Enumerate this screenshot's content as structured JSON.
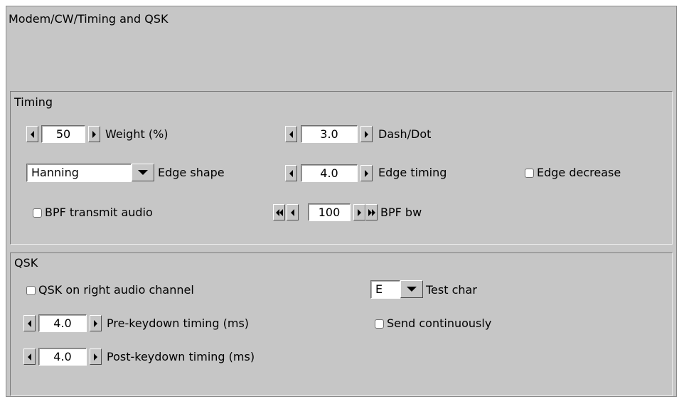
{
  "window": {
    "title": "Modem/CW/Timing and QSK"
  },
  "timing": {
    "group_label": "Timing",
    "weight": {
      "value": "50",
      "label": "Weight (%)"
    },
    "dash_dot": {
      "value": "3.0",
      "label": "Dash/Dot"
    },
    "edge_shape": {
      "value": "Hanning",
      "label": "Edge shape"
    },
    "edge_timing": {
      "value": "4.0",
      "label": "Edge timing"
    },
    "edge_decrease": {
      "label": "Edge decrease",
      "checked": false
    },
    "bpf_transmit_audio": {
      "label": "BPF transmit audio",
      "checked": false
    },
    "bpf_bw": {
      "value": "100",
      "label": "BPF bw"
    }
  },
  "qsk": {
    "group_label": "QSK",
    "right_channel": {
      "label": "QSK on right audio channel",
      "checked": false
    },
    "test_char": {
      "value": "E",
      "label": "Test char"
    },
    "pre_keydown": {
      "value": "4.0",
      "label": "Pre-keydown timing (ms)"
    },
    "send_continuously": {
      "label": "Send continuously",
      "checked": false
    },
    "post_keydown": {
      "value": "4.0",
      "label": "Post-keydown timing (ms)"
    }
  },
  "icons": {
    "decrement": "triangle-left-icon",
    "increment": "triangle-right-icon",
    "fast_decrement": "double-triangle-left-icon",
    "fast_increment": "double-triangle-right-icon",
    "dropdown": "triangle-down-icon"
  },
  "colors": {
    "panel": "#c6c6c6",
    "field": "#ffffff"
  }
}
